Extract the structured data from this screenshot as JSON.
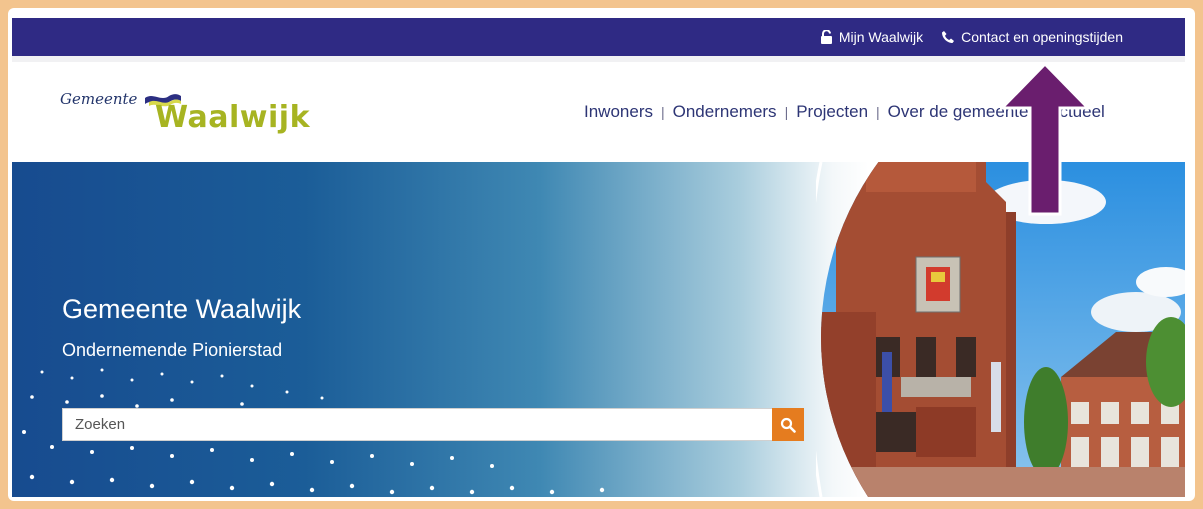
{
  "topbar": {
    "mijn_label": "Mijn Waalwijk",
    "contact_label": "Contact en openingstijden"
  },
  "logo": {
    "prefix": "Gemeente",
    "name": "Waalwijk"
  },
  "nav": {
    "items": [
      "Inwoners",
      "Ondernemers",
      "Projecten",
      "Over de gemeente",
      "Actueel"
    ]
  },
  "hero": {
    "title": "Gemeente Waalwijk",
    "subtitle": "Ondernemende Pionierstad"
  },
  "search": {
    "placeholder": "Zoeken"
  },
  "colors": {
    "topbar": "#2f2a84",
    "accent_orange": "#e57c1f",
    "logo_green": "#a7b422",
    "nav_text": "#2d3575",
    "annotation_arrow": "#6a1e6e"
  },
  "icons": [
    "lock-icon",
    "phone-icon",
    "search-icon",
    "up-arrow-annotation"
  ]
}
